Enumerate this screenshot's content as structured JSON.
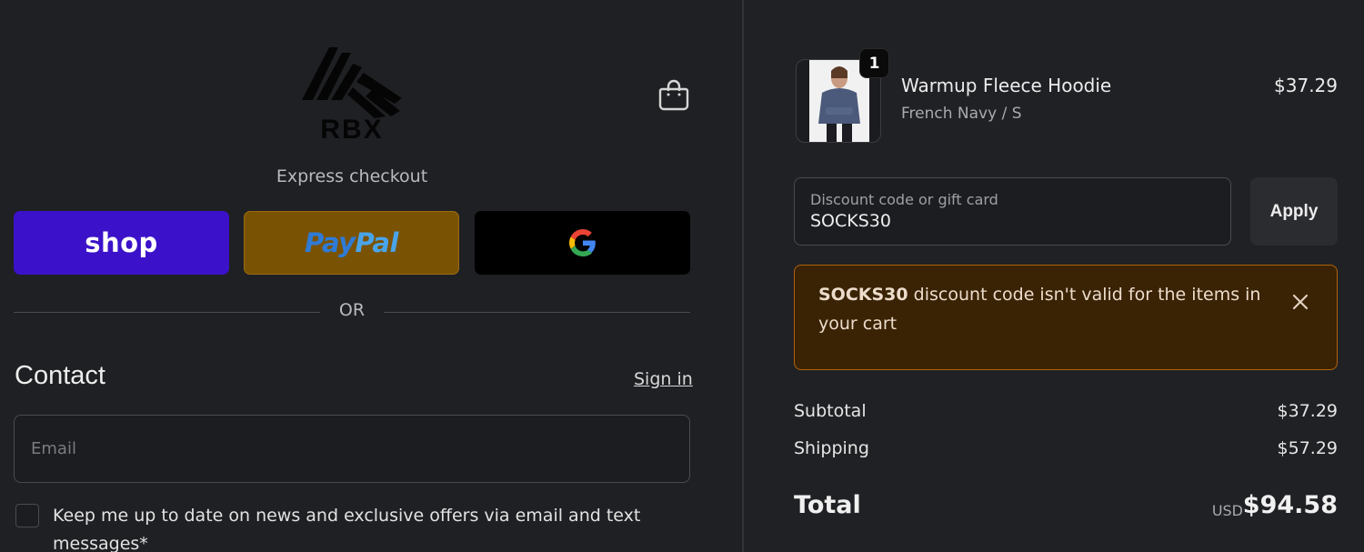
{
  "header": {
    "logo_text": "RBX",
    "express_checkout_label": "Express checkout"
  },
  "express_buttons": {
    "shop_label": "shop",
    "paypal_label_part1": "Pay",
    "paypal_label_part2": "Pal",
    "gpay_icon": "google-g-icon"
  },
  "separator": {
    "or_label": "OR"
  },
  "contact": {
    "title": "Contact",
    "sign_in_label": "Sign in",
    "email_placeholder": "Email",
    "email_value": "",
    "newsletter_label": "Keep me up to date on news and exclusive offers via email and text messages*",
    "newsletter_checked": false
  },
  "order": {
    "item": {
      "quantity": "1",
      "name": "Warmup Fleece Hoodie",
      "variant": "French Navy / S",
      "price": "$37.29"
    },
    "discount": {
      "label": "Discount code or gift card",
      "value": "SOCKS30",
      "apply_label": "Apply"
    },
    "error": {
      "code": "SOCKS30",
      "message": " discount code isn't valid for the items in your cart"
    },
    "summary": {
      "subtotal_label": "Subtotal",
      "subtotal_value": "$37.29",
      "shipping_label": "Shipping",
      "shipping_value": "$57.29",
      "total_label": "Total",
      "currency": "USD",
      "total_value": "$94.58"
    }
  },
  "colors": {
    "background": "#1f2023",
    "shop_purple": "#3b12c9",
    "paypal_gold": "#7a5203",
    "error_bg": "#3a2204",
    "error_border": "#b3630e"
  }
}
